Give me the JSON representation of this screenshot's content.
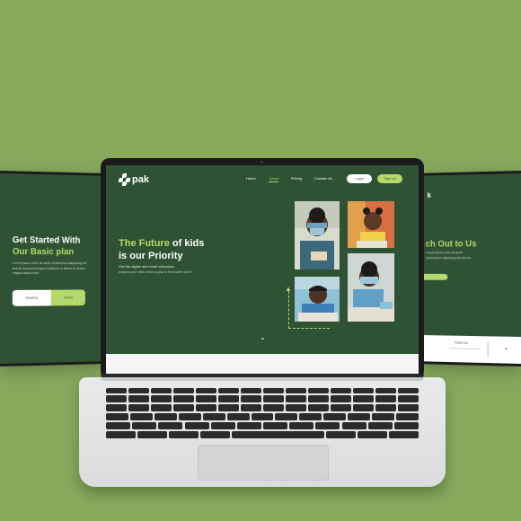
{
  "colors": {
    "background": "#86a95c",
    "panel": "#2f5234",
    "accent": "#b5d86a"
  },
  "left_panel": {
    "title_line1": "Get Started With",
    "title_line2": "Our Basic plan",
    "body": "Lorem ipsum dolor sit amet consectetur adipiscing elit sed do eiusmod tempor incididunt ut labore et dolore magna aliqua enim",
    "button_left": "Monthly",
    "button_right": "Yearly"
  },
  "right_panel": {
    "logo_fragment": "k",
    "title": "ch Out to Us",
    "body": "Lorem ipsum dolor sit amet consectetur adipiscing elit sed do",
    "footer_text": "Follow Us"
  },
  "laptop": {
    "logo": "pak",
    "nav": [
      "Home",
      "About",
      "Pricing",
      "Contact Us"
    ],
    "nav_active": "About",
    "login": "Login",
    "signup": "Sign up",
    "hero": {
      "title_highlight": "The Future",
      "title_rest": " of kids",
      "title_line2": "is our Priority",
      "subtitle": "Get the digital and smart education",
      "subtitle2": "program your child needs to grow in the modern world"
    },
    "photos": [
      "child-with-mask",
      "girl-with-pencil",
      "boy-at-desk",
      "girl-with-mask"
    ]
  },
  "icons": {
    "arrow": "arrow-up-icon",
    "chevron": "chevron-up-icon"
  }
}
